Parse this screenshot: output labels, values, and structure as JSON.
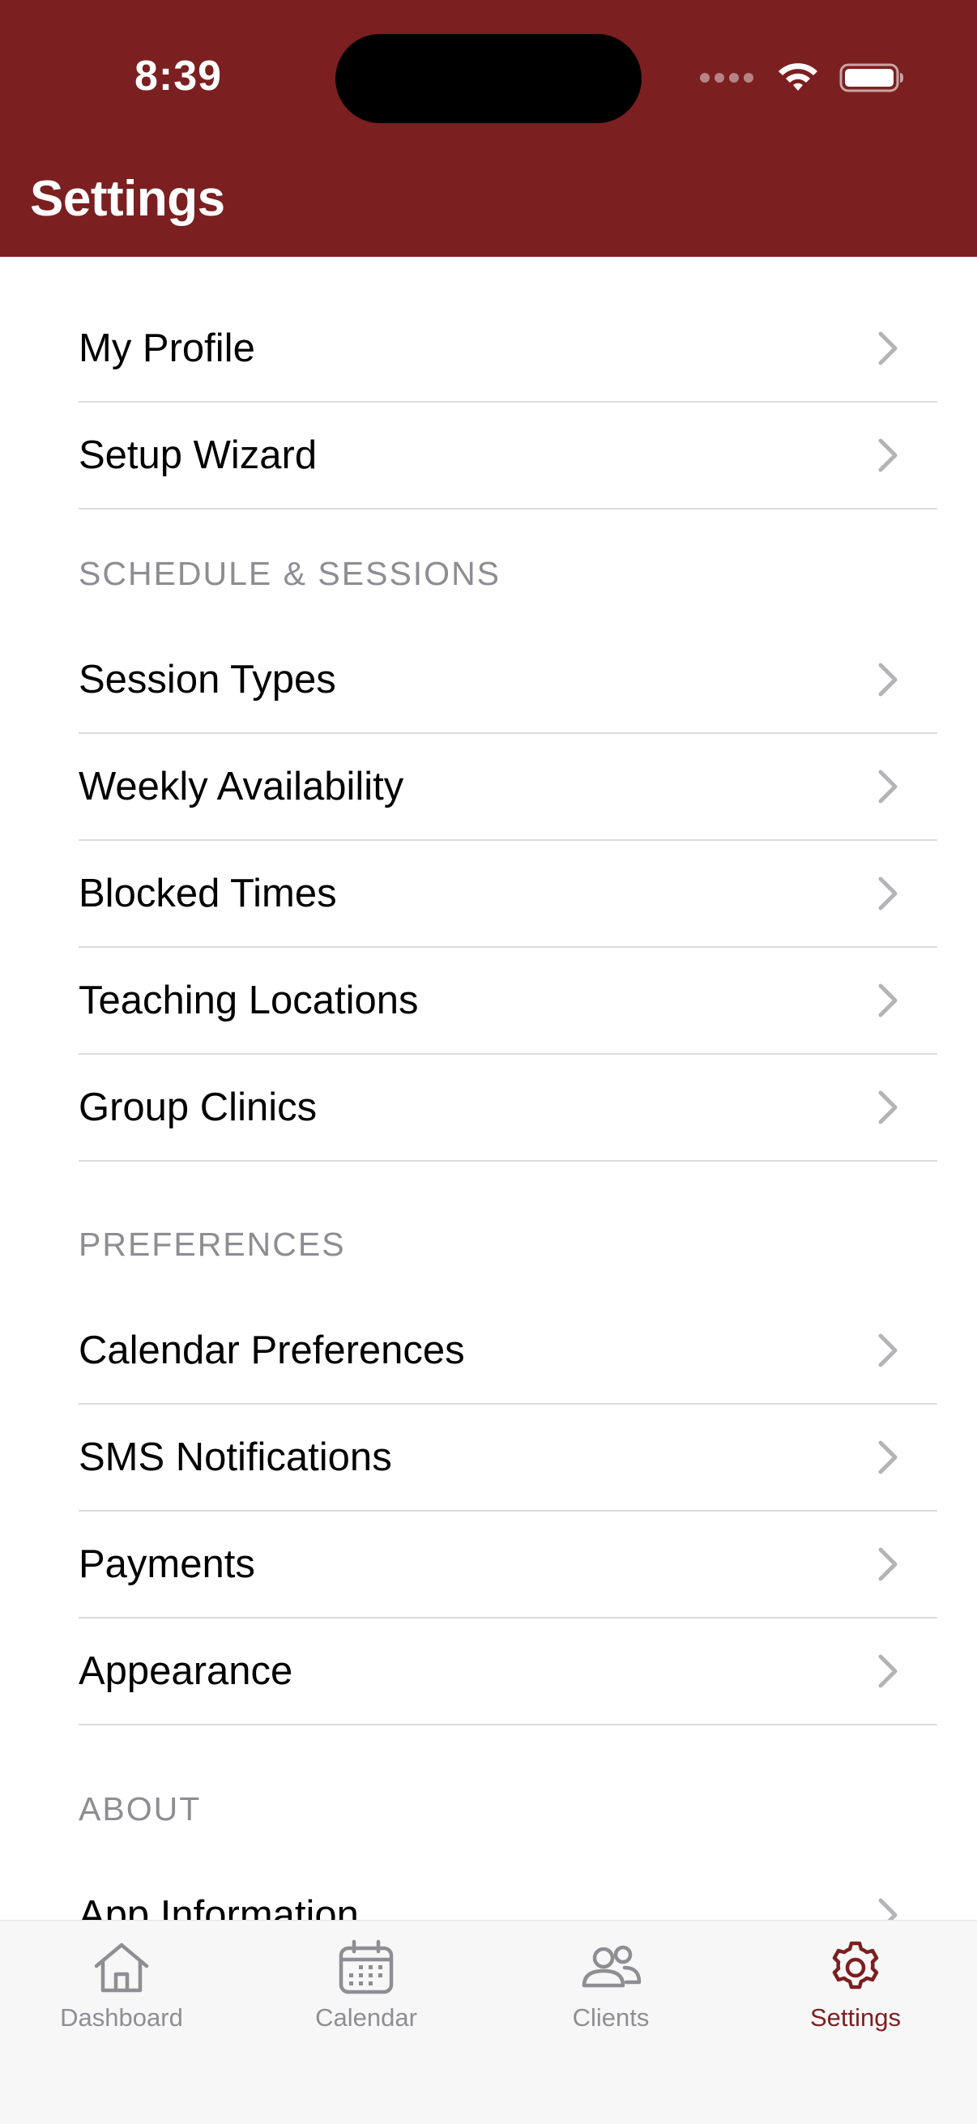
{
  "status_bar": {
    "time": "8:39"
  },
  "header": {
    "title": "Settings"
  },
  "rows_top": [
    {
      "label": "My Profile"
    },
    {
      "label": "Setup Wizard"
    }
  ],
  "schedule_section": {
    "title": "SCHEDULE & SESSIONS",
    "items": [
      {
        "label": "Session Types"
      },
      {
        "label": "Weekly Availability"
      },
      {
        "label": "Blocked Times"
      },
      {
        "label": "Teaching Locations"
      },
      {
        "label": "Group Clinics"
      }
    ]
  },
  "preferences_section": {
    "title": "PREFERENCES",
    "items": [
      {
        "label": "Calendar Preferences"
      },
      {
        "label": "SMS Notifications"
      },
      {
        "label": "Payments"
      },
      {
        "label": "Appearance"
      }
    ]
  },
  "about_section": {
    "title": "ABOUT",
    "items": [
      {
        "label": "App Information"
      }
    ]
  },
  "tab_bar": {
    "tabs": [
      {
        "label": "Dashboard",
        "icon": "house-icon"
      },
      {
        "label": "Calendar",
        "icon": "calendar-icon"
      },
      {
        "label": "Clients",
        "icon": "people-icon"
      },
      {
        "label": "Settings",
        "icon": "gear-icon",
        "active": true
      }
    ]
  },
  "colors": {
    "brand": "#7b1f20",
    "separator": "#dcdcde",
    "inactive": "#8e8e93"
  }
}
